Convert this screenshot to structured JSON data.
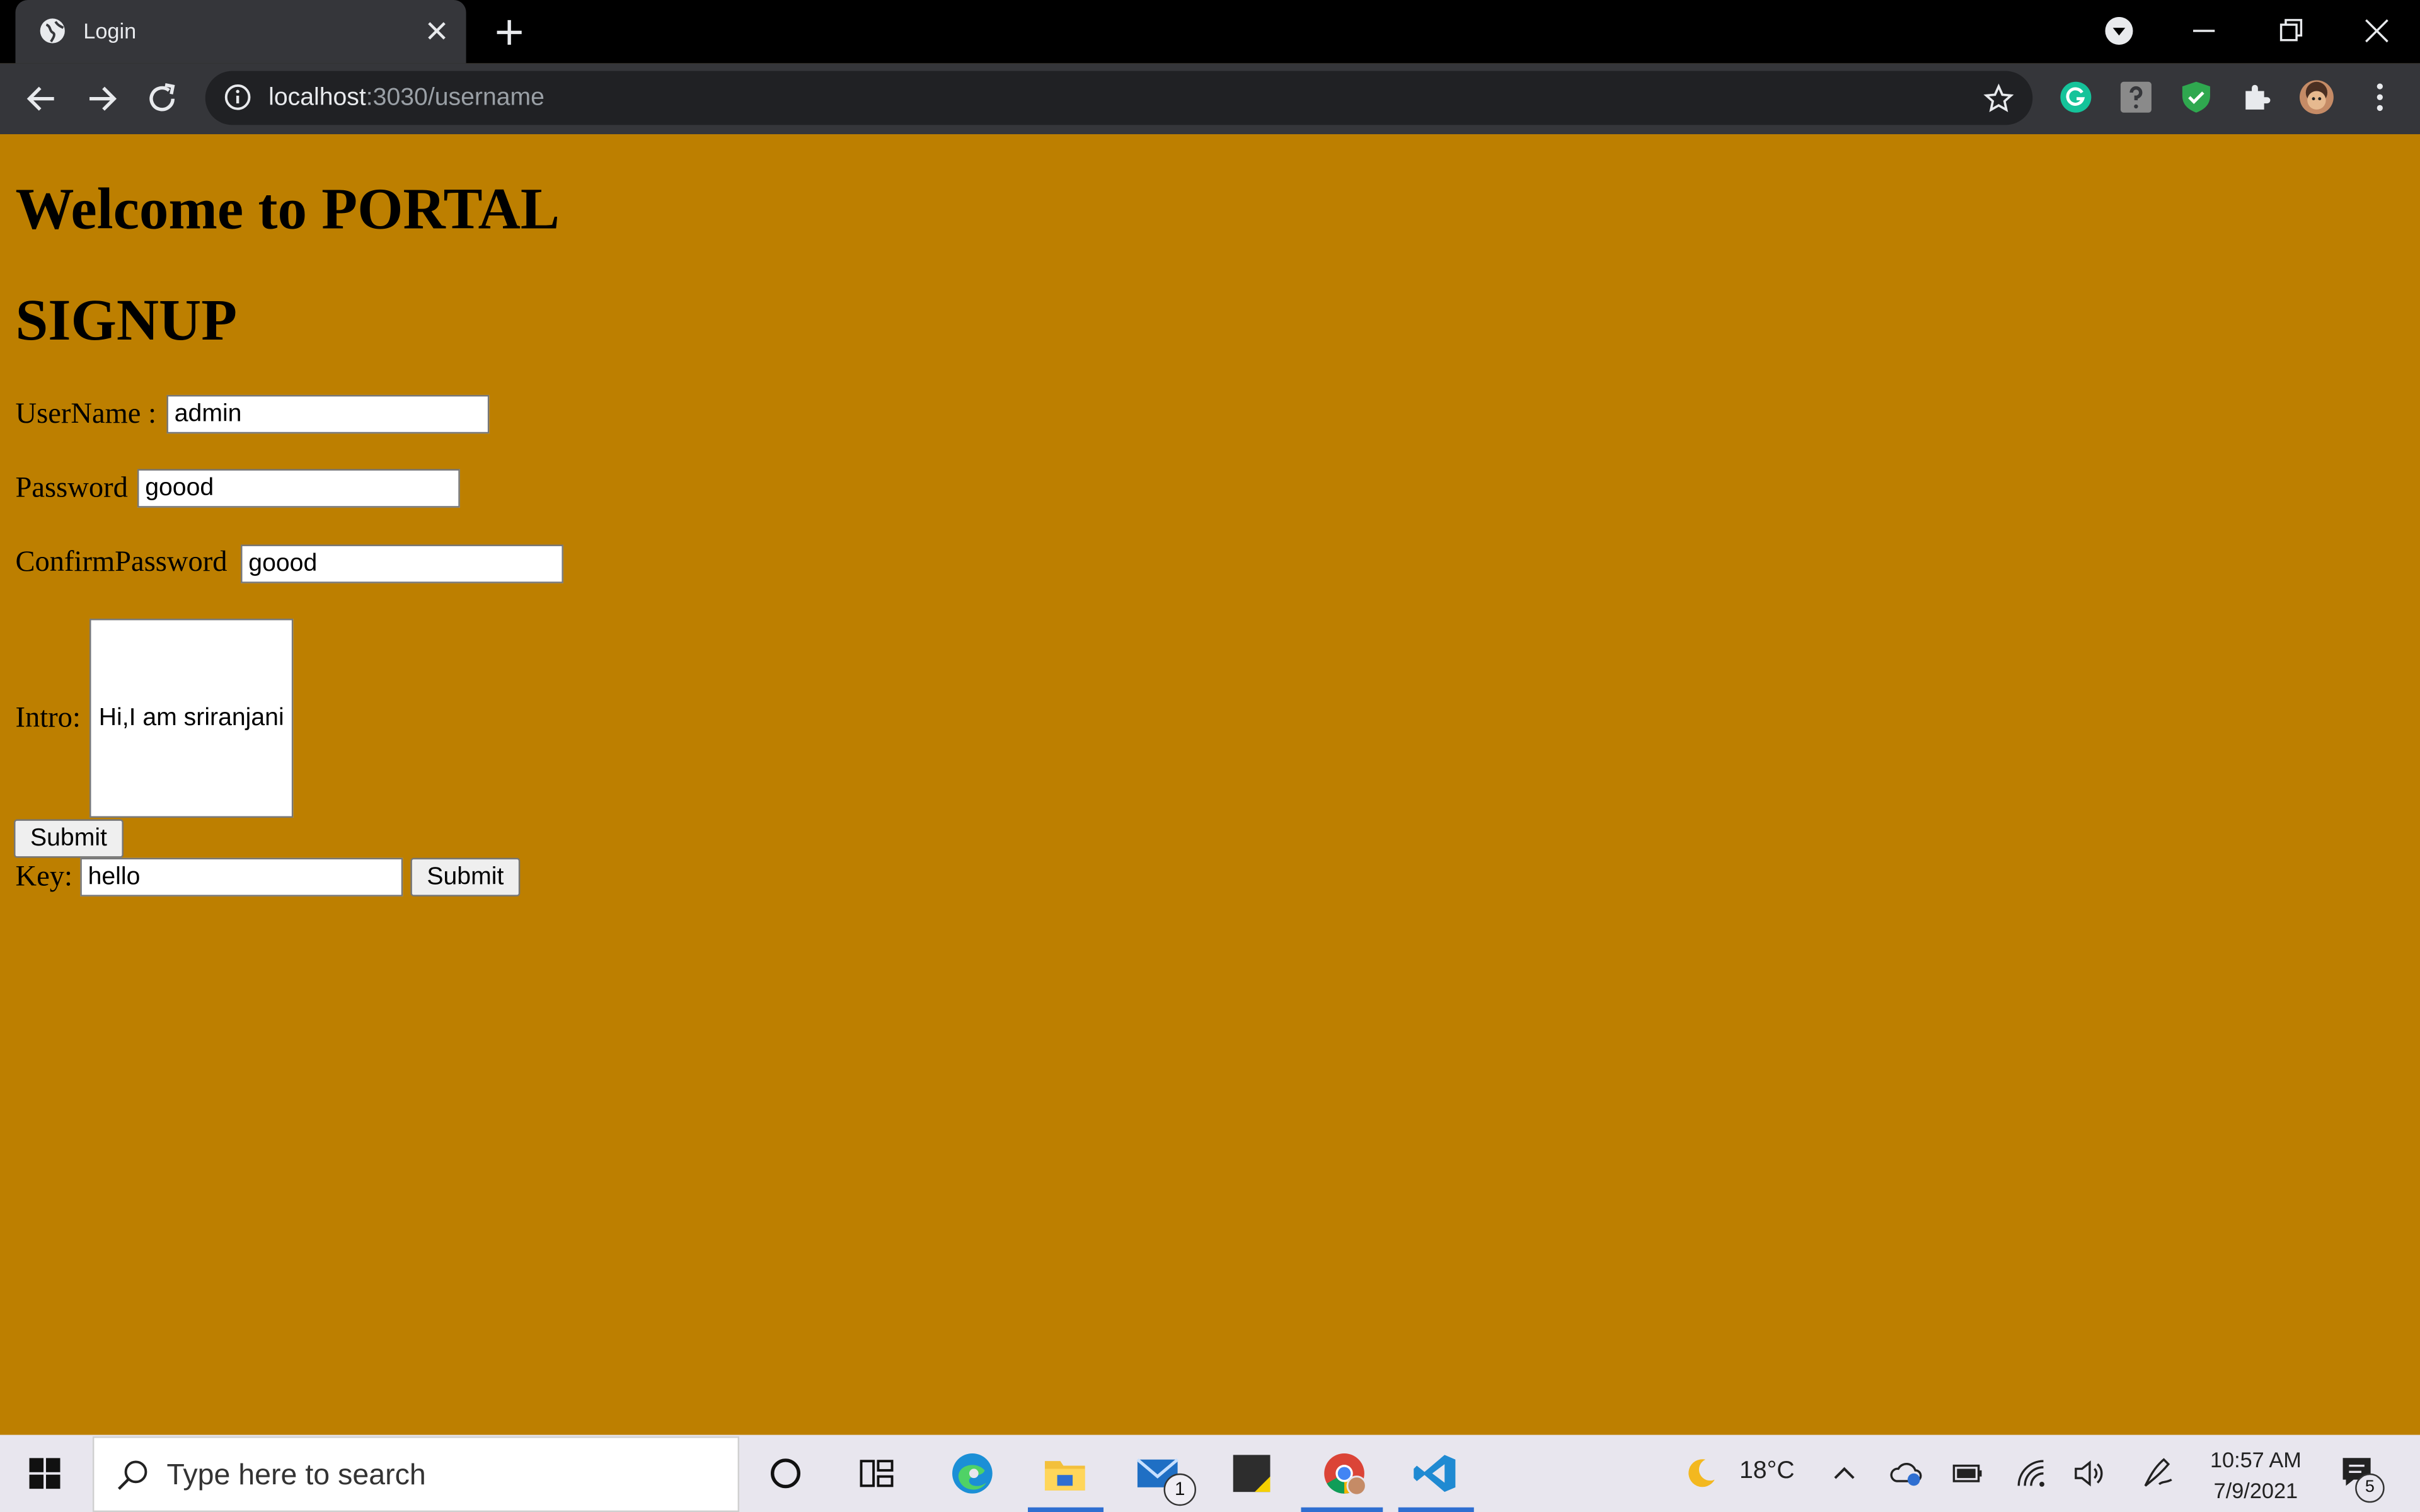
{
  "browser": {
    "tab_title": "Login",
    "url_host": "localhost",
    "url_path": ":3030/username"
  },
  "page": {
    "heading": "Welcome to PORTAL",
    "subheading": "SIGNUP",
    "form": {
      "username_label": "UserName :",
      "username_value": "admin",
      "password_label": "Password",
      "password_value": "goood",
      "confirm_label": "ConfirmPassword",
      "confirm_value": "goood",
      "intro_label": "Intro:",
      "intro_value": "Hi,I am sriranjani",
      "submit_label": "Submit"
    },
    "key_form": {
      "key_label": "Key:",
      "key_value": "hello",
      "submit_label": "Submit"
    }
  },
  "taskbar": {
    "search_placeholder": "Type here to search",
    "weather": "18°C",
    "time": "10:57 AM",
    "date": "7/9/2021",
    "mail_badge": "1",
    "notification_badge": "5"
  },
  "colors": {
    "page_background": "#bd7f00",
    "chrome_dark": "#35363a",
    "tab_strip": "#000000"
  }
}
